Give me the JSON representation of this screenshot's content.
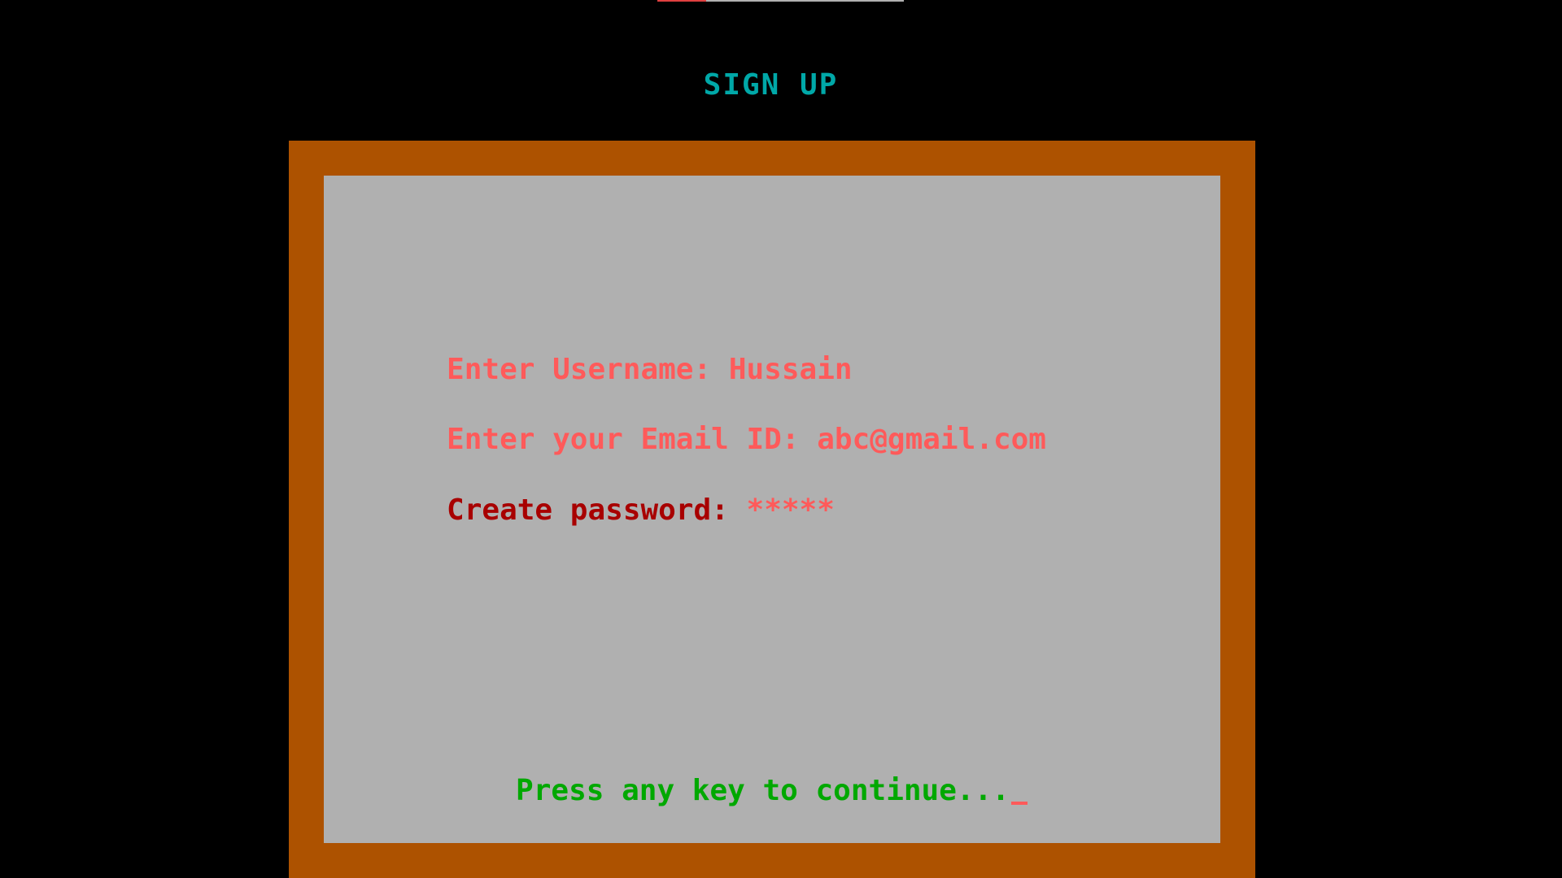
{
  "screen": {
    "title": "SIGN UP"
  },
  "form": {
    "username_label": "Enter Username: ",
    "username_value": "Hussain",
    "email_label": "Enter your Email ID: ",
    "email_value": "abc@gmail.com",
    "password_label": "Create password: ",
    "password_value": "*****"
  },
  "prompt": {
    "continue_text": "Press any key to continue..."
  },
  "colors": {
    "background": "#000000",
    "frame": "#ad5200",
    "panel": "#b0b0b0",
    "title": "#00a8a8",
    "label_light_red": "#ff5a5a",
    "label_dark_red": "#a80000",
    "prompt_green": "#00a800"
  }
}
